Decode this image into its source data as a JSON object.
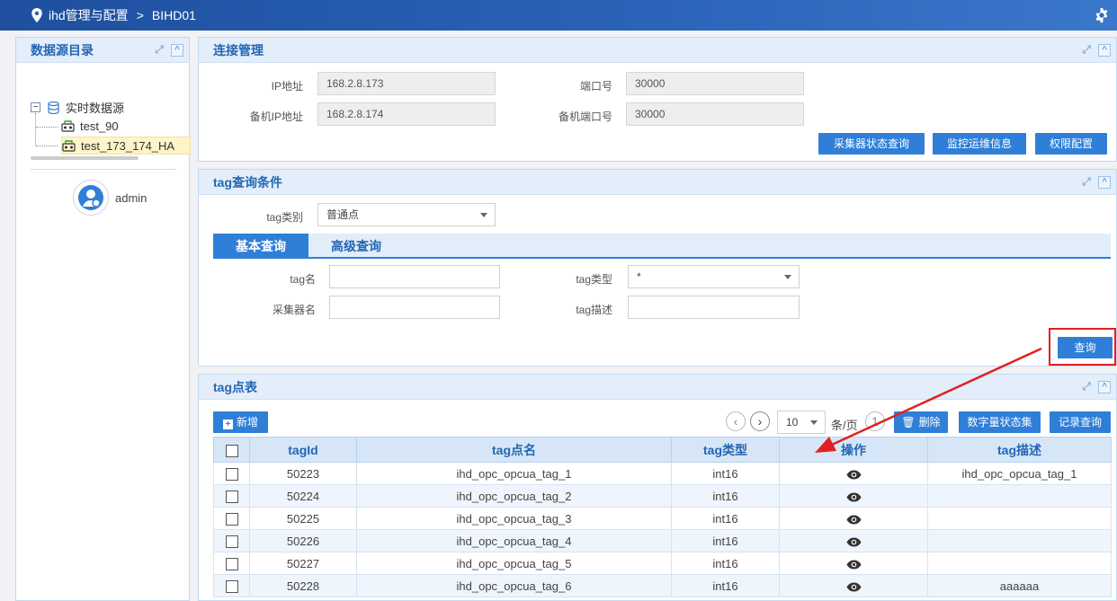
{
  "topbar": {
    "title": "ihd管理与配置",
    "separator": ">",
    "crumb": "BIHD01"
  },
  "sidebar": {
    "title": "数据源目录",
    "tree": {
      "toggle": "−",
      "root": "实时数据源",
      "children": [
        "test_90",
        "test_173_174_HA"
      ]
    },
    "user": "admin"
  },
  "connection": {
    "title": "连接管理",
    "ip_label": "IP地址",
    "ip_value": "168.2.8.173",
    "port_label": "端口号",
    "port_value": "30000",
    "backup_ip_label": "备机IP地址",
    "backup_ip_value": "168.2.8.174",
    "backup_port_label": "备机端口号",
    "backup_port_value": "30000",
    "buttons": [
      "采集器状态查询",
      "监控运维信息",
      "权限配置"
    ]
  },
  "query": {
    "title": "tag查询条件",
    "category_label": "tag类别",
    "category_value": "普通点",
    "tabs": [
      "基本查询",
      "高级查询"
    ],
    "tag_name_label": "tag名",
    "tag_type_label": "tag类型",
    "tag_type_value": "*",
    "collector_label": "采集器名",
    "tag_desc_label": "tag描述",
    "search_button": "查询"
  },
  "table": {
    "title": "tag点表",
    "add_button": "新增",
    "page_size": "10",
    "page_size_unit": "条/页",
    "delete_button": "删除",
    "digital_button": "数字量状态集",
    "record_button": "记录查询",
    "columns": [
      "tagId",
      "tag点名",
      "tag类型",
      "操作",
      "tag描述"
    ],
    "rows": [
      {
        "id": "50223",
        "name": "ihd_opc_opcua_tag_1",
        "type": "int16",
        "desc": "ihd_opc_opcua_tag_1"
      },
      {
        "id": "50224",
        "name": "ihd_opc_opcua_tag_2",
        "type": "int16",
        "desc": ""
      },
      {
        "id": "50225",
        "name": "ihd_opc_opcua_tag_3",
        "type": "int16",
        "desc": ""
      },
      {
        "id": "50226",
        "name": "ihd_opc_opcua_tag_4",
        "type": "int16",
        "desc": ""
      },
      {
        "id": "50227",
        "name": "ihd_opc_opcua_tag_5",
        "type": "int16",
        "desc": ""
      },
      {
        "id": "50228",
        "name": "ihd_opc_opcua_tag_6",
        "type": "int16",
        "desc": "aaaaaa"
      }
    ]
  },
  "colors": {
    "primary": "#2f7fd8",
    "header_text": "#2466b4",
    "annotation": "#e02020"
  }
}
